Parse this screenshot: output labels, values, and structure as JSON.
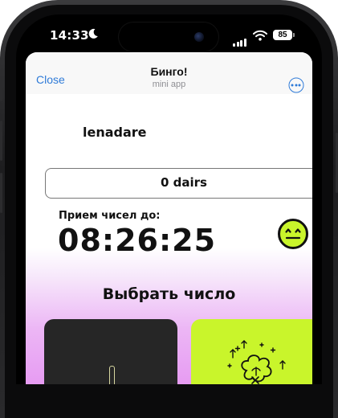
{
  "status_bar": {
    "time": "14:33",
    "battery": "85"
  },
  "mini_app": {
    "close_label": "Close",
    "title": "Бинго!",
    "subtitle": "mini app"
  },
  "profile": {
    "username": "lenadare"
  },
  "balance": {
    "text": "0 dairs"
  },
  "timer": {
    "label": "Прием чисел до:",
    "value": "08:26:25"
  },
  "picker": {
    "title": "Выбрать число"
  },
  "colors": {
    "accent_blue": "#2f7bd8",
    "lime": "#c9f52b",
    "dark_card": "#262626",
    "pink_gradient": "#e699f2"
  }
}
